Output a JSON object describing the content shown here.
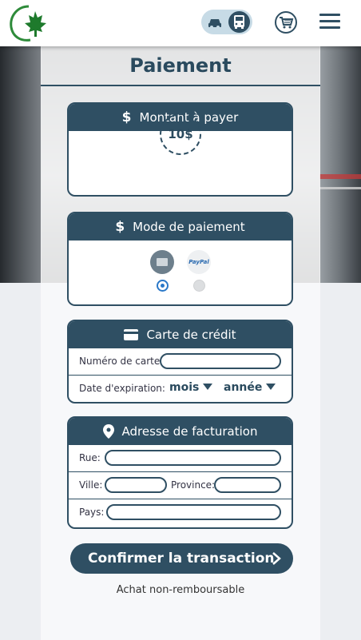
{
  "header": {
    "logo_icon": "maple-leaf-logo-icon",
    "mode_toggle": {
      "car_icon": "car-icon",
      "bus_icon": "bus-icon",
      "selected": "bus"
    },
    "cart_icon": "shopping-cart-icon",
    "menu_icon": "hamburger-menu-icon"
  },
  "page": {
    "title": "Paiement"
  },
  "amount_card": {
    "title": "Montant à payer",
    "icon": "dollar-icon",
    "value": "10$"
  },
  "payment_mode_card": {
    "title": "Mode de paiement",
    "icon": "dollar-icon",
    "options": [
      {
        "name": "credit-card",
        "icon": "credit-card-icon",
        "selected": true
      },
      {
        "name": "paypal",
        "icon": "paypal-icon",
        "label": "PayPal",
        "selected": false
      }
    ]
  },
  "credit_card": {
    "title": "Carte de crédit",
    "icon": "credit-card-icon",
    "number_label": "Numéro de carte:",
    "number_value": "",
    "expiry_label": "Date d'expiration:",
    "month_select": "mois",
    "year_select": "année"
  },
  "billing": {
    "title": "Adresse de facturation",
    "icon": "location-pin-icon",
    "street_label": "Rue:",
    "city_label": "Ville:",
    "province_label": "Province:",
    "country_label": "Pays:"
  },
  "actions": {
    "confirm_label": "Confirmer la transaction",
    "confirm_icon": "chevron-right-icon",
    "note": "Achat non-remboursable"
  },
  "colors": {
    "primary": "#2f4f63",
    "toggle_bg": "#c7dbe6",
    "radio_accent": "#2a78c8"
  }
}
